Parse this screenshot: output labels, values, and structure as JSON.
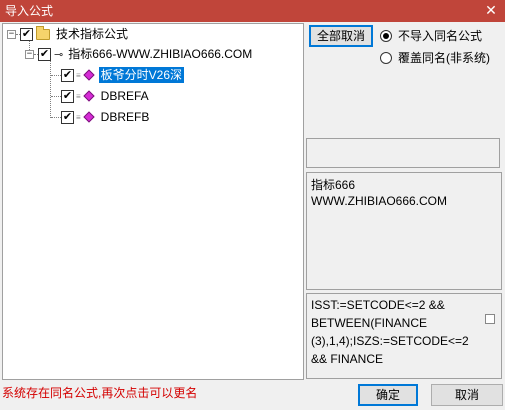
{
  "window": {
    "title": "导入公式",
    "close_glyph": "✕"
  },
  "tree": {
    "root": {
      "label": "技术指标公式",
      "expanded": true,
      "checked": true,
      "expander": "−"
    },
    "group": {
      "label": "指标666-WWW.ZHIBIAO666.COM",
      "expanded": true,
      "checked": true,
      "expander": "−"
    },
    "items": [
      {
        "label": "板爷分时V26深",
        "checked": true,
        "selected": true
      },
      {
        "label": "DBREFA",
        "checked": true,
        "selected": false
      },
      {
        "label": "DBREFB",
        "checked": true,
        "selected": false
      }
    ],
    "check_glyph": "✔",
    "key_glyph": "⊸"
  },
  "controls": {
    "cancel_all_label": "全部取消",
    "radio_skip_label": "不导入同名公式",
    "radio_overwrite_label": "覆盖同名(非系统)",
    "selected_option": "skip"
  },
  "info_panel": {
    "line1": "指标666",
    "line2": "WWW.ZHIBIAO666.COM"
  },
  "code_panel": {
    "line1": "ISST:=SETCODE<=2 &&",
    "line2": "BETWEEN(FINANCE",
    "line3": "(3),1,4);ISZS:=SETCODE<=2",
    "line4": "&& FINANCE"
  },
  "footer": {
    "status_text": "系统存在同名公式,再次点击可以更名",
    "ok_label": "确定",
    "cancel_label": "取消"
  },
  "colors": {
    "titlebar": "#c0453a",
    "selection": "#0078d7",
    "status_text": "#d40000",
    "diamond": "#d62bd6"
  }
}
